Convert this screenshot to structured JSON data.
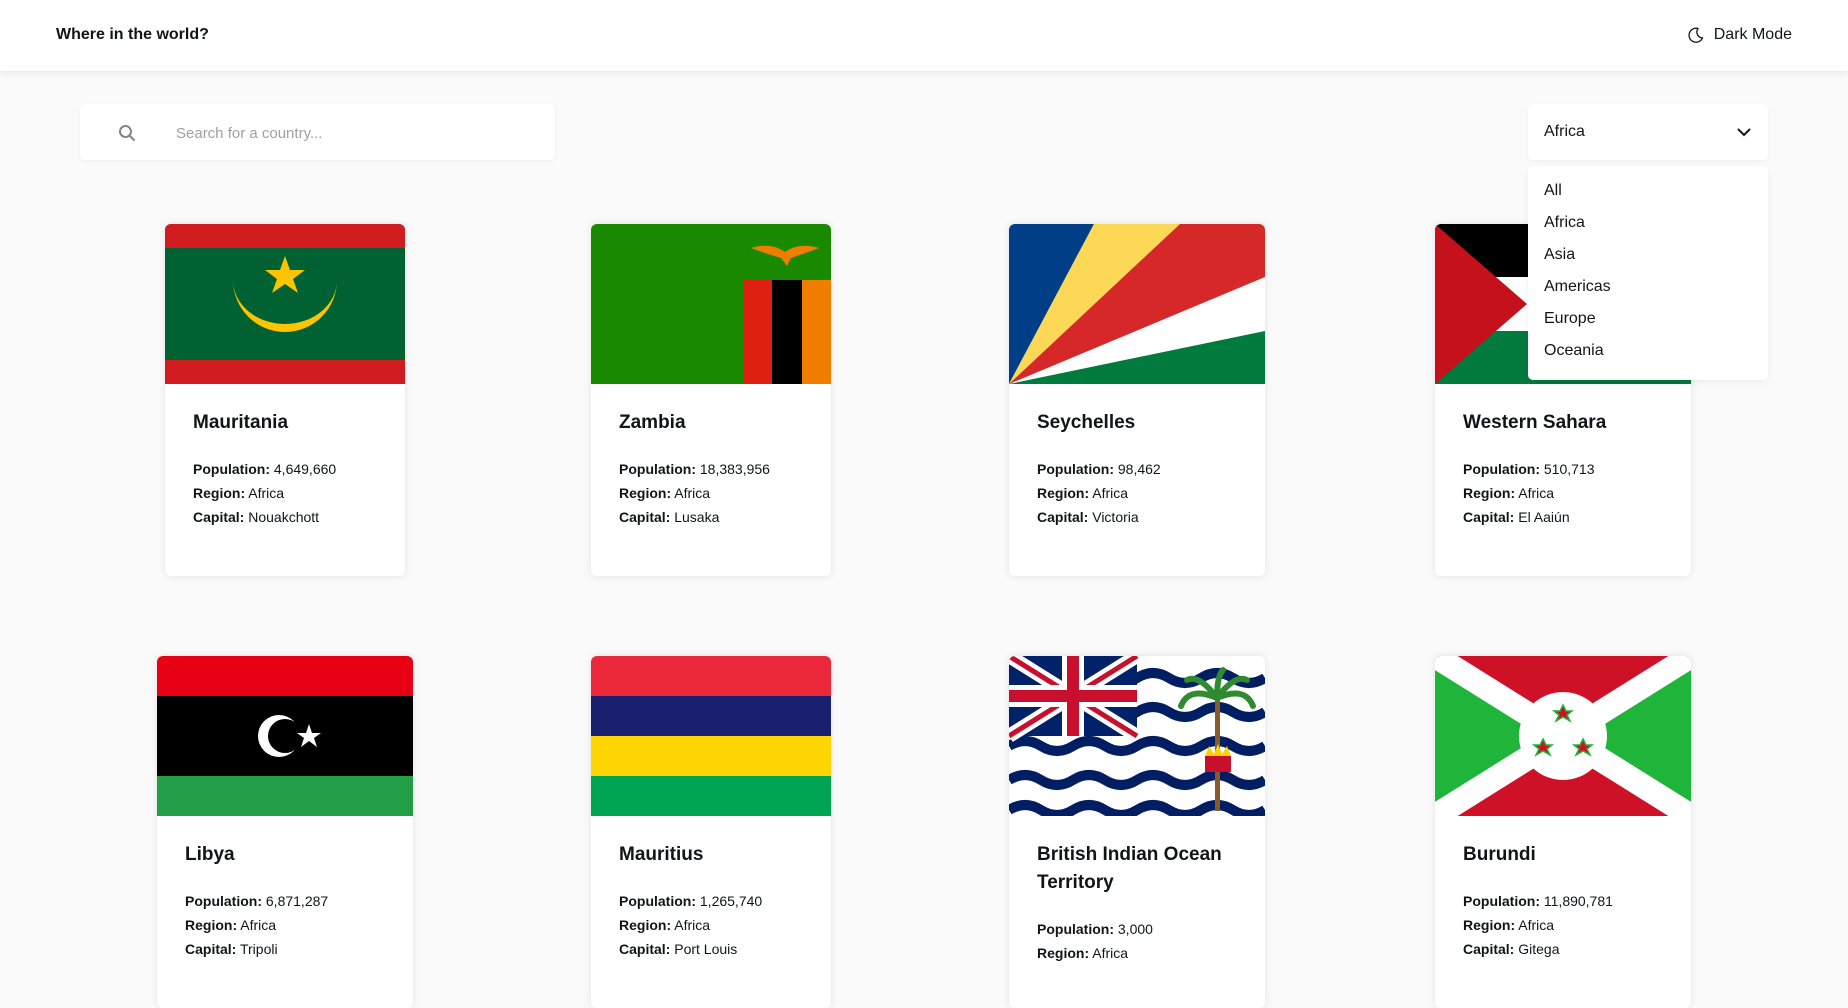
{
  "header": {
    "title": "Where in the world?",
    "dark_mode_label": "Dark Mode",
    "icon": "moon-icon"
  },
  "search": {
    "placeholder": "Search for a country...",
    "value": "",
    "icon": "search-icon"
  },
  "filter": {
    "selected": "Africa",
    "options": [
      "All",
      "Africa",
      "Asia",
      "Americas",
      "Europe",
      "Oceania"
    ]
  },
  "labels": {
    "population": "Population:",
    "region": "Region:",
    "capital": "Capital:"
  },
  "countries": [
    {
      "name": "Mauritania",
      "population": "4,649,660",
      "region": "Africa",
      "capital": "Nouakchott",
      "flag": "mauritania-flag"
    },
    {
      "name": "Zambia",
      "population": "18,383,956",
      "region": "Africa",
      "capital": "Lusaka",
      "flag": "zambia-flag"
    },
    {
      "name": "Seychelles",
      "population": "98,462",
      "region": "Africa",
      "capital": "Victoria",
      "flag": "seychelles-flag"
    },
    {
      "name": "Western Sahara",
      "population": "510,713",
      "region": "Africa",
      "capital": "El Aaiún",
      "flag": "western-sahara-flag"
    },
    {
      "name": "Libya",
      "population": "6,871,287",
      "region": "Africa",
      "capital": "Tripoli",
      "flag": "libya-flag"
    },
    {
      "name": "Mauritius",
      "population": "1,265,740",
      "region": "Africa",
      "capital": "Port Louis",
      "flag": "mauritius-flag"
    },
    {
      "name": "British Indian Ocean Territory",
      "population": "3,000",
      "region": "Africa",
      "capital": "",
      "flag": "british-indian-ocean-territory-flag"
    },
    {
      "name": "Burundi",
      "population": "11,890,781",
      "region": "Africa",
      "capital": "Gitega",
      "flag": "burundi-flag"
    }
  ]
}
